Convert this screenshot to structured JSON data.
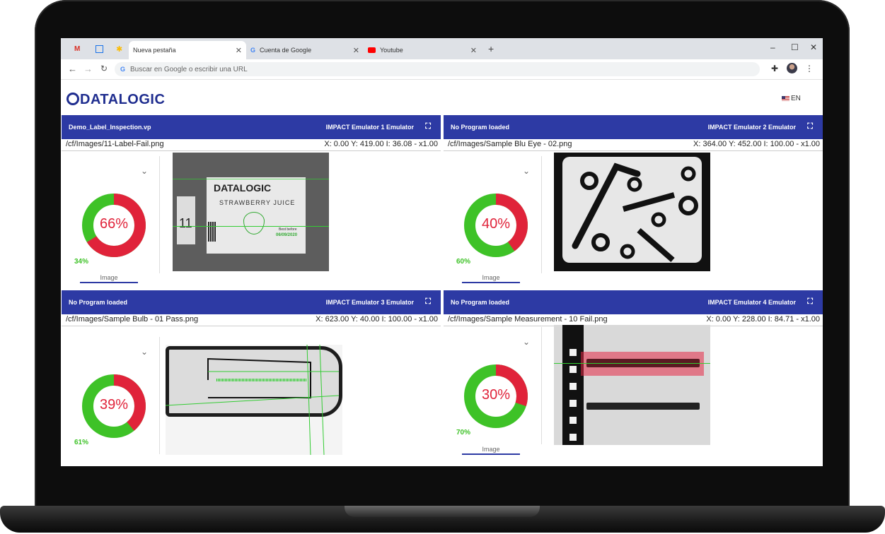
{
  "browser": {
    "tabs": [
      {
        "label": "Nueva pestaña",
        "active": true
      },
      {
        "label": "Cuenta de Google",
        "active": false
      },
      {
        "label": "Youtube",
        "active": false
      }
    ],
    "new_tab": "+",
    "address_placeholder": "Buscar en Google o escribir una URL"
  },
  "app": {
    "logo": "DATALOGIC",
    "language": "EN"
  },
  "panels": [
    {
      "program": "Demo_Label_Inspection.vp",
      "emulator": "IMPACT Emulator 1 Emulator",
      "path": "/cf/Images/11-Label-Fail.png",
      "coords": "X: 0.00 Y: 419.00  I: 36.08  - x1.00",
      "fail_pct": 66,
      "fail_label": "66%",
      "pass_label": "34%",
      "image_tab": "Image"
    },
    {
      "program": "No Program loaded",
      "emulator": "IMPACT Emulator 2 Emulator",
      "path": "/cf/Images/Sample Blu Eye - 02.png",
      "coords": "X: 364.00 Y: 452.00  I: 100.00  - x1.00",
      "fail_pct": 40,
      "fail_label": "40%",
      "pass_label": "60%",
      "image_tab": "Image"
    },
    {
      "program": "No Program loaded",
      "emulator": "IMPACT Emulator 3 Emulator",
      "path": "/cf/Images/Sample Bulb - 01 Pass.png",
      "coords": "X: 623.00 Y: 40.00  I: 100.00  - x1.00",
      "fail_pct": 39,
      "fail_label": "39%",
      "pass_label": "61%",
      "image_tab": ""
    },
    {
      "program": "No Program loaded",
      "emulator": "IMPACT Emulator 4 Emulator",
      "path": "/cf/Images/Sample Measurement - 10 Fail.png",
      "coords": "X: 0.00 Y: 228.00  I: 84.71  - x1.00",
      "fail_pct": 30,
      "fail_label": "30%",
      "pass_label": "70%",
      "image_tab": "Image"
    }
  ],
  "label_image": {
    "brand": "DATALOGIC",
    "product": "STRAWBERRY JUICE",
    "best_before": "Best before",
    "date": "06/09/2020",
    "lot": "11"
  },
  "colors": {
    "header": "#2d3aa4",
    "fail": "#e0233a",
    "pass": "#3ec227"
  }
}
